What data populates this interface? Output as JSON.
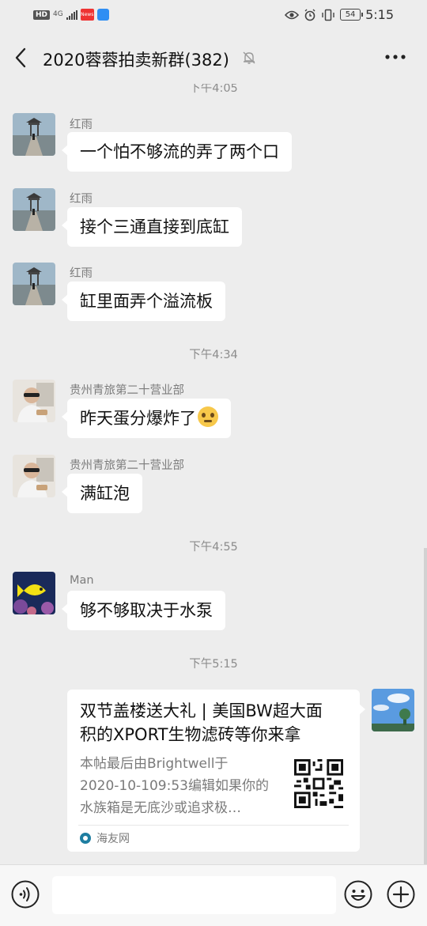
{
  "statusbar": {
    "hd": "HD",
    "net": "4G",
    "news": "News",
    "battery": "54",
    "time": "5:15"
  },
  "header": {
    "title": "2020蓉蓉拍卖新群(382)"
  },
  "timestamps": {
    "t1": "下午4:05",
    "t2": "下午4:34",
    "t3": "下午4:55",
    "t4": "下午5:15"
  },
  "messages": [
    {
      "sender": "红雨",
      "text": "一个怕不够流的弄了两个口"
    },
    {
      "sender": "红雨",
      "text": "接个三通直接到底缸"
    },
    {
      "sender": "红雨",
      "text": "缸里面弄个溢流板"
    },
    {
      "sender": "贵州青旅第二十营业部",
      "text": "昨天蛋分爆炸了"
    },
    {
      "sender": "贵州青旅第二十营业部",
      "text": "满缸泡"
    },
    {
      "sender": "Man",
      "text": "够不够取决于水泵"
    }
  ],
  "card": {
    "title": "双节盖楼送大礼 | 美国BW超大面\n积的XPORT生物滤砖等你来拿",
    "desc": "本帖最后由Brightwell于\n2020-10-109:53编辑如果你的\n水族箱是无底沙或追求极…",
    "source": "海友网"
  },
  "icons": {
    "back": "back-arrow-icon",
    "mute": "bell-muted-icon",
    "more": "more-dots-icon",
    "voice": "voice-icon",
    "emoji": "emoji-icon",
    "plus": "plus-icon",
    "emoji_inline": "woozy-face-emoji"
  },
  "colors": {
    "background": "#ededed",
    "bubble": "#ffffff",
    "input_bar": "#f7f7f7",
    "timestamp_text": "#8c8c8c"
  }
}
